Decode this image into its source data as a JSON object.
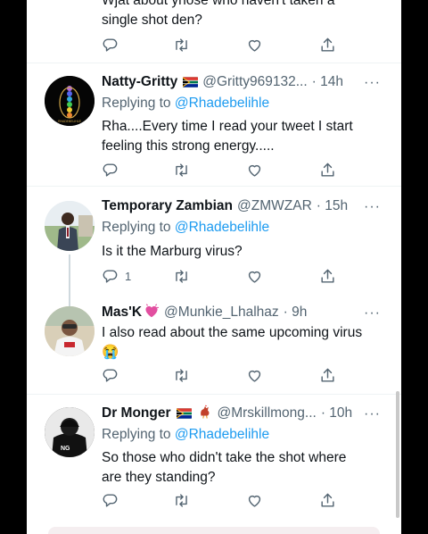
{
  "tweets": [
    {
      "text_line1": "Wjat about yhose who haven't taken a",
      "text_line2": "single shot den?"
    },
    {
      "name": "Natty-Gritty",
      "handle": "@Gritty969132...",
      "time": "· 14h",
      "replying_prefix": "Replying to",
      "replying_to": "@Rhadebelihle",
      "text_line1": "Rha....Every time I read your tweet I start",
      "text_line2": "feeling this strong energy.....",
      "avatar_caption": "RHADEBELIHLE"
    },
    {
      "name": "Temporary Zambian",
      "handle": "@ZMWZAR",
      "time": "· 15h",
      "replying_prefix": "Replying to",
      "replying_to": "@Rhadebelihle",
      "text_line1": "Is it the Marburg virus?",
      "reply_count": "1"
    },
    {
      "name": "Mas'K",
      "handle": "@Munkie_Lhalhaz",
      "time": "· 9h",
      "text_line1": "I also read about the same upcoming virus",
      "text_emoji": "😭"
    },
    {
      "name": "Dr Monger",
      "handle": "@Mrskillmong...",
      "time": "· 10h",
      "replying_prefix": "Replying to",
      "replying_to": "@Rhadebelihle",
      "text_line1": "So those who didn't take the shot where",
      "text_line2": "are they standing?"
    }
  ],
  "colors": {
    "accent": "#1d9bf0",
    "secondary_text": "#536471",
    "primary_text": "#0f1419"
  },
  "icons": [
    "reply-icon",
    "retweet-icon",
    "like-icon",
    "share-icon",
    "more-icon",
    "south-africa-flag-icon",
    "heart-emoji-icon",
    "cock-emoji-icon"
  ]
}
